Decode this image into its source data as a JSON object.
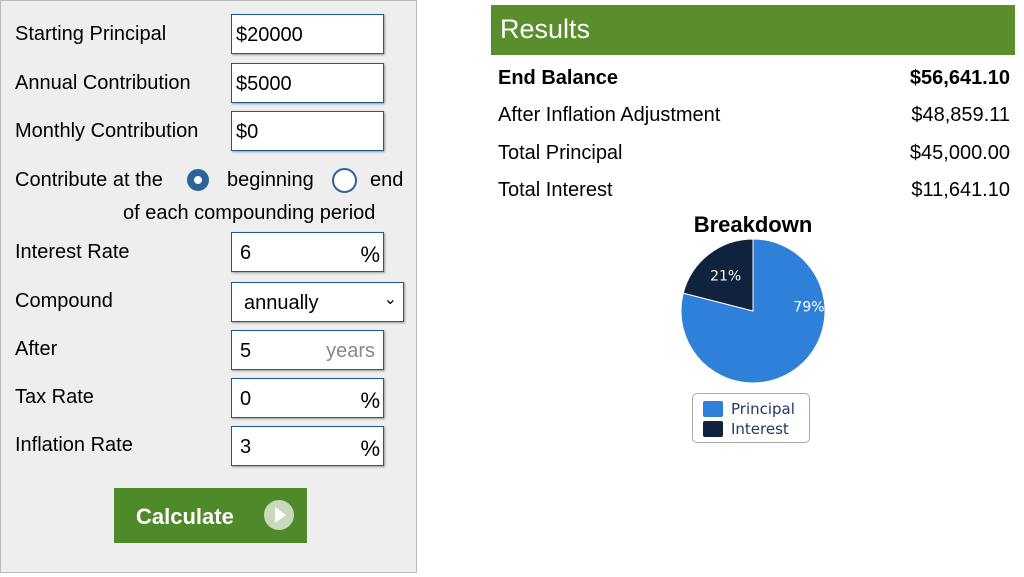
{
  "form": {
    "starting_principal": {
      "label": "Starting Principal",
      "value": "$20000"
    },
    "annual_contribution": {
      "label": "Annual Contribution",
      "value": "$5000"
    },
    "monthly_contribution": {
      "label": "Monthly Contribution",
      "value": "$0"
    },
    "contribute_label": "Contribute at the",
    "option_beginning": "beginning",
    "option_end": "end",
    "contribute_suffix": "of each compounding period",
    "selected_timing": "beginning",
    "interest_rate": {
      "label": "Interest Rate",
      "value": "6",
      "suffix": "%"
    },
    "compound": {
      "label": "Compound",
      "value": "annually"
    },
    "after": {
      "label": "After",
      "value": "5",
      "suffix": "years"
    },
    "tax_rate": {
      "label": "Tax Rate",
      "value": "0",
      "suffix": "%"
    },
    "inflation_rate": {
      "label": "Inflation Rate",
      "value": "3",
      "suffix": "%"
    },
    "calculate_label": "Calculate"
  },
  "results": {
    "title": "Results",
    "rows": [
      {
        "label": "End Balance",
        "value": "$56,641.10"
      },
      {
        "label": "After Inflation Adjustment",
        "value": "$48,859.11"
      },
      {
        "label": "Total Principal",
        "value": "$45,000.00"
      },
      {
        "label": "Total Interest",
        "value": "$11,641.10"
      }
    ]
  },
  "chart_data": {
    "type": "pie",
    "title": "Breakdown",
    "categories": [
      "Principal",
      "Interest"
    ],
    "values": [
      79,
      21
    ],
    "labels": [
      "79%",
      "21%"
    ],
    "colors": [
      "#2f80d8",
      "#10223d"
    ],
    "legend": "bottom"
  }
}
